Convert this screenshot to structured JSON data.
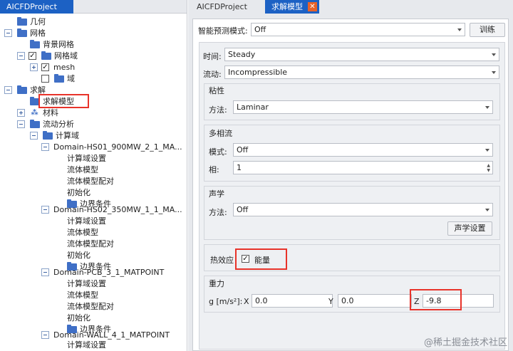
{
  "left": {
    "tab_title": "AICFDProject",
    "tree": [
      {
        "label": "几何"
      },
      {
        "label": "网格"
      },
      {
        "label": "背景网格"
      },
      {
        "label": "网格域"
      },
      {
        "label": "mesh"
      },
      {
        "label": "域"
      },
      {
        "label": "求解"
      },
      {
        "label": "求解模型"
      },
      {
        "label": "材料"
      },
      {
        "label": "流动分析"
      },
      {
        "label": "计算域"
      },
      {
        "label": "Domain-HS01_900MW_2_1_MA..."
      },
      {
        "label": "计算域设置"
      },
      {
        "label": "流体模型"
      },
      {
        "label": "流体模型配对"
      },
      {
        "label": "初始化"
      },
      {
        "label": "边界条件"
      },
      {
        "label": "Domain-HS02_350MW_1_1_MA..."
      },
      {
        "label": "计算域设置"
      },
      {
        "label": "流体模型"
      },
      {
        "label": "流体模型配对"
      },
      {
        "label": "初始化"
      },
      {
        "label": "边界条件"
      },
      {
        "label": "Domain-PCB_3_1_MATPOINT"
      },
      {
        "label": "计算域设置"
      },
      {
        "label": "流体模型"
      },
      {
        "label": "流体模型配对"
      },
      {
        "label": "初始化"
      },
      {
        "label": "边界条件"
      },
      {
        "label": "Domain-WALL_4_1_MATPOINT"
      },
      {
        "label": "计算域设置"
      }
    ]
  },
  "right": {
    "tab_project": "AICFDProject",
    "tab_active": "求解模型",
    "close_glyph": "✕",
    "smart_mode_label": "智能预测模式:",
    "smart_mode_value": "Off",
    "train_button": "训练",
    "time_label": "时间:",
    "time_value": "Steady",
    "flow_label": "流动:",
    "flow_value": "Incompressible",
    "viscosity": {
      "title": "粘性",
      "method_label": "方法:",
      "method_value": "Laminar"
    },
    "multiphase": {
      "title": "多相流",
      "model_label": "模式:",
      "model_value": "Off",
      "phase_label": "相:",
      "phase_value": "1"
    },
    "acoustics": {
      "title": "声学",
      "method_label": "方法:",
      "method_value": "Off",
      "settings_button": "声学设置"
    },
    "thermal": {
      "label": "热效应",
      "checkbox_mark": "✓",
      "energy_label": "能量"
    },
    "gravity": {
      "title": "重力",
      "g_label": "g [m/s²]:",
      "x_label": "X",
      "x_value": "0.0",
      "y_label": "Y",
      "y_value": "0.0",
      "z_label": "Z",
      "z_value": "-9.8"
    }
  },
  "watermark": "@稀土掘金技术社区",
  "colors": {
    "accent": "#1c61c4",
    "highlight": "#e8332a",
    "close": "#e6622a"
  }
}
